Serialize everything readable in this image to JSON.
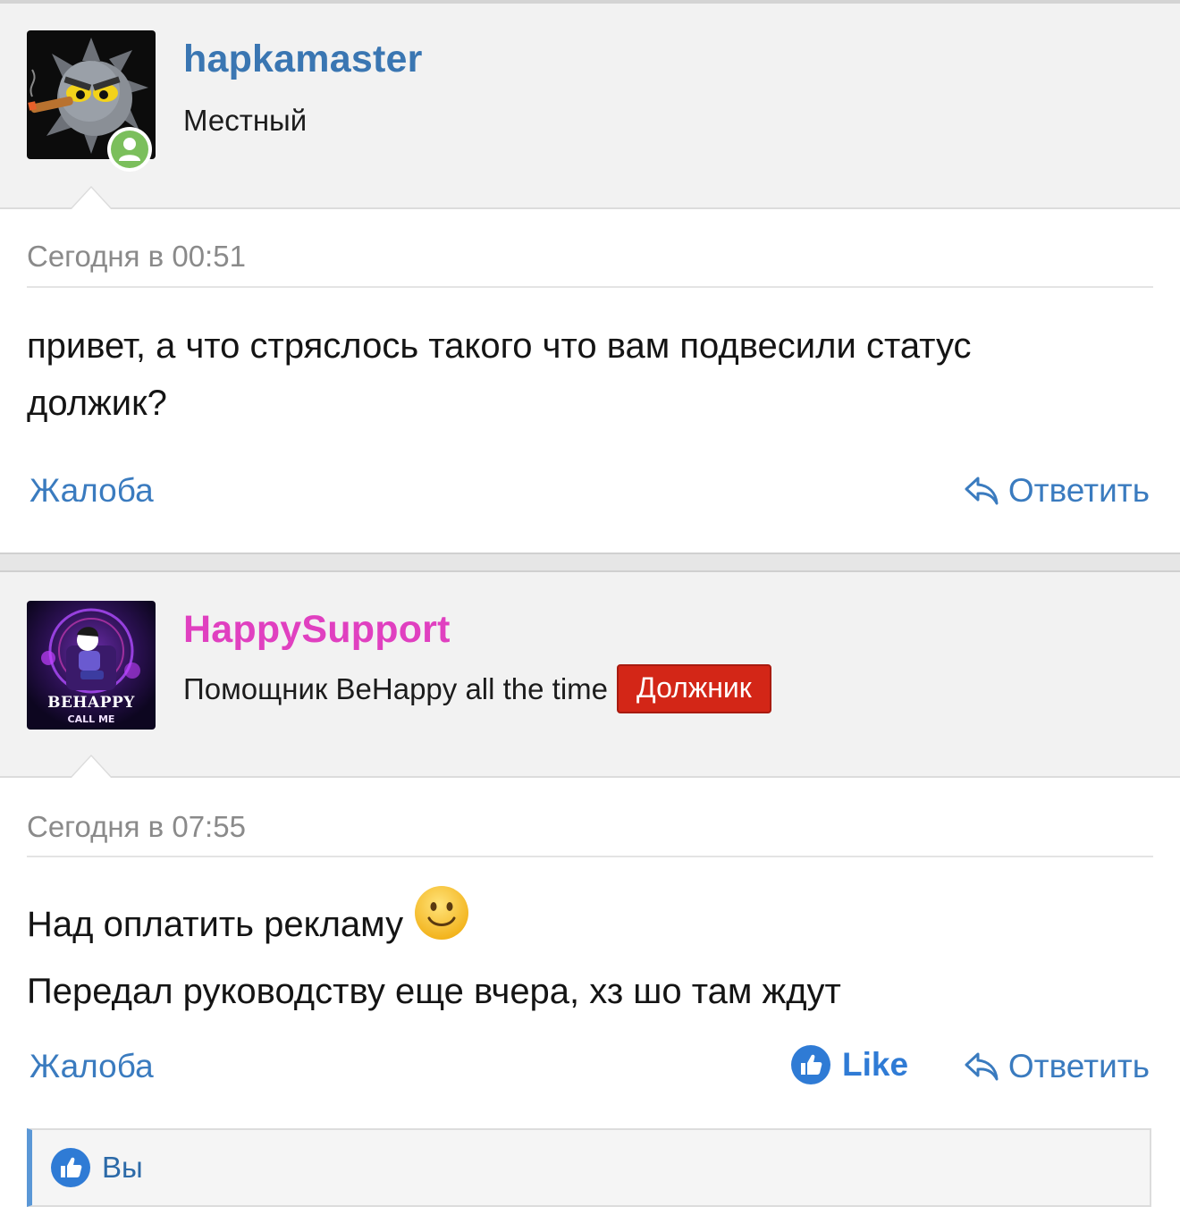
{
  "colors": {
    "link": "#3a7bbf",
    "username_local": "#3a76b2",
    "username_support": "#e040c0",
    "debtor_badge": "#d32617",
    "online": "#7bbf5c",
    "like_blue": "#2f7bd5"
  },
  "posts": [
    {
      "username": "hapkamaster",
      "user_title": "Местный",
      "avatar_icon": "spiky-ball-mascot-avatar",
      "online": true,
      "date": "Сегодня в 00:51",
      "body_lines": [
        "привет, а что стряслось такого что вам подвесили статус",
        "должик?"
      ],
      "actions": {
        "report": "Жалоба",
        "reply": "Ответить"
      }
    },
    {
      "username": "HappySupport",
      "user_title": "Помощник BeHappy all the time",
      "badge": "Должник",
      "avatar_icon": "behappy-call-me-avatar",
      "avatar_text": [
        "BEHAPPY",
        "CALL ME"
      ],
      "date": "Сегодня в 07:55",
      "body_lines": [
        "Над оплатить рекламу",
        "Передал руководству еще вчера, хз шо там ждут"
      ],
      "emoji": "smiling-face-emoji",
      "actions": {
        "report": "Жалоба",
        "like": "Like",
        "reply": "Ответить"
      },
      "likes": "Вы"
    }
  ]
}
